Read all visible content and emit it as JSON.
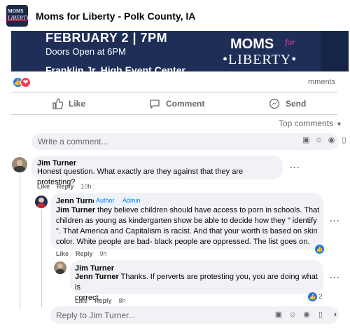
{
  "page": {
    "name": "Moms for Liberty - Polk County, IA",
    "logo_line1": "MOMS",
    "logo_line2": "LIBERTY"
  },
  "banner": {
    "date_line": "FEBRUARY 2 | 7PM",
    "doors_line": "Doors Open at 6PM",
    "venue_line": "Franklin Jr. High Event Center",
    "logo_moms": "MOMS",
    "logo_for": "for",
    "logo_liberty": "•LIBERTY•"
  },
  "post": {
    "comments_label": "mments",
    "reaction_icons": [
      "like-icon",
      "love-icon"
    ]
  },
  "actions": {
    "like": "Like",
    "comment": "Comment",
    "send": "Send"
  },
  "sort": {
    "label": "Top comments"
  },
  "composer": {
    "placeholder": "Write a comment...",
    "icons": [
      "sticker-icon",
      "emoji-icon",
      "camera-icon",
      "gif-icon",
      "sticker-face-icon"
    ]
  },
  "comments": [
    {
      "author": "Jim Turner",
      "text": "Honest question. What exactly are they against that they are protesting?",
      "like": "Like",
      "reply": "Reply",
      "time": "10h"
    },
    {
      "author": "Jenn Turner",
      "badges": [
        "Author",
        "Admin"
      ],
      "mention": "Jim Turner",
      "text_lines": [
        " they believe children should have access to porn in schools. That",
        "children as young as kindergarten show be able to decide how they \" identify",
        "\". That America and Capitalism is racist. And that your worth is based on skin",
        "color. White people are bad- black people are oppressed. The list goes on."
      ],
      "like": "Like",
      "reply": "Reply",
      "time": "9h"
    },
    {
      "author": "Jim Turner",
      "mention": "Jenn Turner",
      "text_lines": [
        " Thanks. If perverts are protesting you, you are doing what is",
        "correct."
      ],
      "like": "Like",
      "reply": "Reply",
      "time": "8h",
      "reaction_count": "2"
    }
  ],
  "reply_composer": {
    "placeholder": "Reply to Jim Turner..."
  }
}
